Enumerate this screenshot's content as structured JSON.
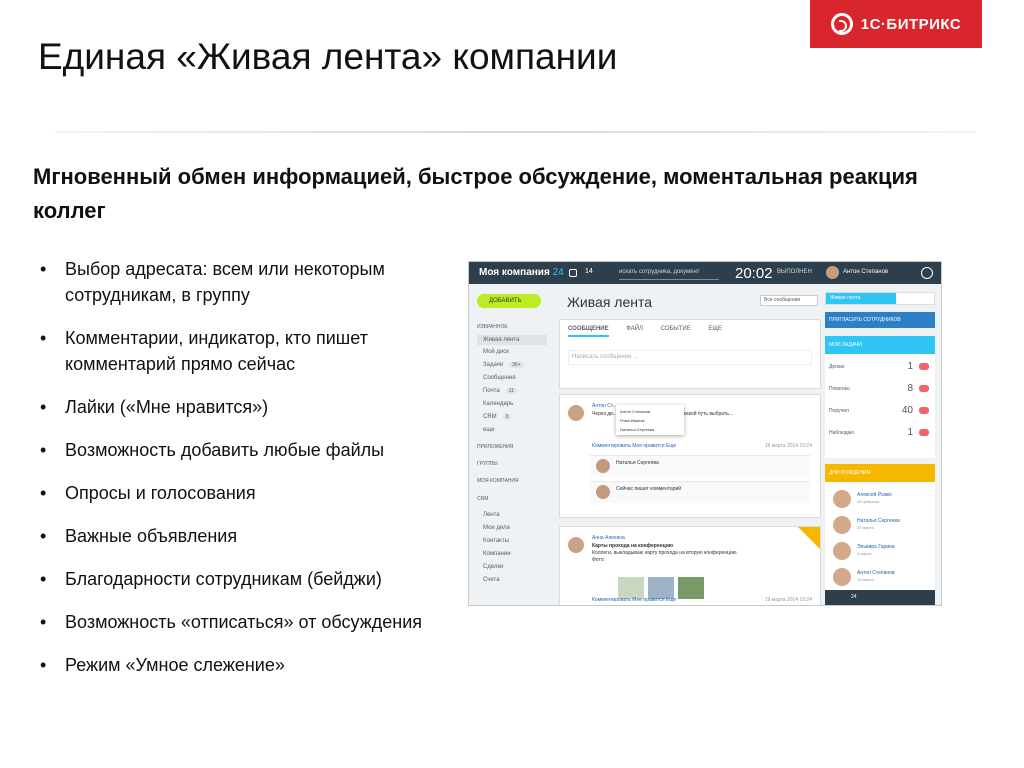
{
  "slide": {
    "title": "Единая «Живая лента» компании",
    "subtitle": "Мгновенный обмен информацией, быстрое обсуждение, моментальная реакция коллег",
    "logo_text": "1С·БИТРИКС",
    "logo_color": "#d9262c",
    "bullets": [
      "Выбор адресата: всем или некоторым сотрудникам, в группу",
      "Комментарии, индикатор, кто пишет комментарий прямо сейчас",
      "Лайки («Мне нравится»)",
      "Возможность добавить любые файлы",
      "Опросы и голосования",
      "Важные объявления",
      "Благодарности сотрудникам (бейджи)",
      "Возможность «отписаться» от обсуждения",
      "Режим «Умное слежение»"
    ]
  },
  "app": {
    "company": "Моя компания",
    "company_num": "24",
    "messages_count": "14",
    "search_placeholder": "искать сотрудника, документ",
    "time": "20:02",
    "work_status": "ВЫПОЛНЕН",
    "user_name": "Антон Степанов",
    "add_button": "ДОБАВИТЬ",
    "nav": {
      "favorites": "ИЗБРАННОЕ",
      "items": [
        "Живая лента",
        "Мой диск",
        "Задачи",
        "Сообщения",
        "Почта",
        "Календарь",
        "CRM",
        "еще"
      ],
      "counts": {
        "tasks": "36+",
        "mail": "11",
        "crm": "3"
      },
      "apps": "ПРИЛОЖЕНИЯ",
      "groups": "ГРУППЫ",
      "company_section": "МОЯ КОМПАНИЯ",
      "crm_section": "CRM",
      "sub_items": [
        "Лента",
        "Мои дела",
        "Контакты",
        "Компании",
        "Сделки",
        "Счета"
      ]
    },
    "feed": {
      "title": "Живая лента",
      "filter": "Все сообщения",
      "tabs": [
        "СООБЩЕНИЕ",
        "ФАЙЛ",
        "СОБЫТИЕ",
        "ЕЩЕ"
      ],
      "composer_placeholder": "Написать сообщение ...",
      "post1": {
        "author": "Антон Ст...",
        "text": "Через дв... Нужно определиться с тем, какой путь выбрать...",
        "popup_names": [
          "Антон Степанов",
          "Рома Иванов",
          "Наталья Сергеева"
        ],
        "actions": "Комментировать   Мне нравится   Еще",
        "date": "19 марта 2014 10:24",
        "comment1_author": "Наталья Сергеева",
        "comment2": "Сейчас пишет комментарий"
      },
      "post2": {
        "author": "Анна Алехина",
        "heading": "Карты прохода на конференцию",
        "text": "Коллеги, выкладываю карту прохода на вторую конференцию.",
        "photos_label": "Фото:",
        "actions": "Комментировать   Мне нравится   Еще",
        "date": "19 марта 2014 10:24"
      }
    },
    "right": {
      "calendar_tab": "Живая лента",
      "invite": "ПРИГЛАСИТЬ СОТРУДНИКОВ",
      "tasks_title": "МОИ ЗАДАЧИ",
      "tasks": [
        {
          "label": "Делаю",
          "value": "1"
        },
        {
          "label": "Помогаю",
          "value": "8"
        },
        {
          "label": "Поручил",
          "value": "40"
        },
        {
          "label": "Наблюдаю",
          "value": "1"
        }
      ],
      "birthdays_title": "ДНИ РОЖДЕНИЯ",
      "birthdays": [
        {
          "name": "Алексей Рожко",
          "date": "25 февраля"
        },
        {
          "name": "Наталья Сергеева",
          "date": "29 марта"
        },
        {
          "name": "Эльвира Гарина",
          "date": "8 марта"
        },
        {
          "name": "Антон Степанов",
          "date": "15 марта"
        }
      ],
      "bottom_counter": "24"
    }
  }
}
